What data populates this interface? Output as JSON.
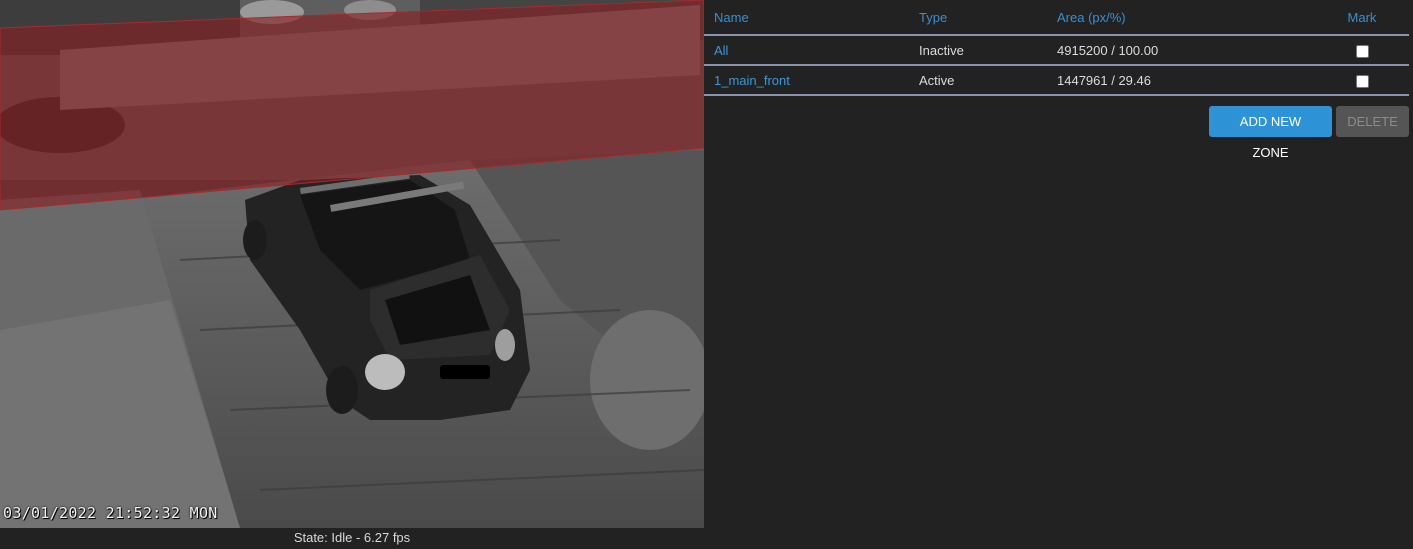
{
  "camera": {
    "timestamp": "03/01/2022 21:52:32 MON",
    "overlay_text": "",
    "state_text": "State: Idle - 6.27 fps",
    "zone_overlay_color": "#8b1e22"
  },
  "zones_table": {
    "headers": {
      "name": "Name",
      "type": "Type",
      "area": "Area (px/%)",
      "mark": "Mark"
    },
    "rows": [
      {
        "name": "All",
        "type": "Inactive",
        "area": "4915200 / 100.00",
        "marked": false
      },
      {
        "name": "1_main_front",
        "type": "Active",
        "area": "1447961 / 29.46",
        "marked": false
      }
    ]
  },
  "buttons": {
    "add_new_zone": "ADD NEW ZONE",
    "delete": "DELETE"
  },
  "colors": {
    "accent": "#2e93d6",
    "link": "#3a98d8",
    "background": "#222222",
    "row_divider": "#8b92b0"
  }
}
